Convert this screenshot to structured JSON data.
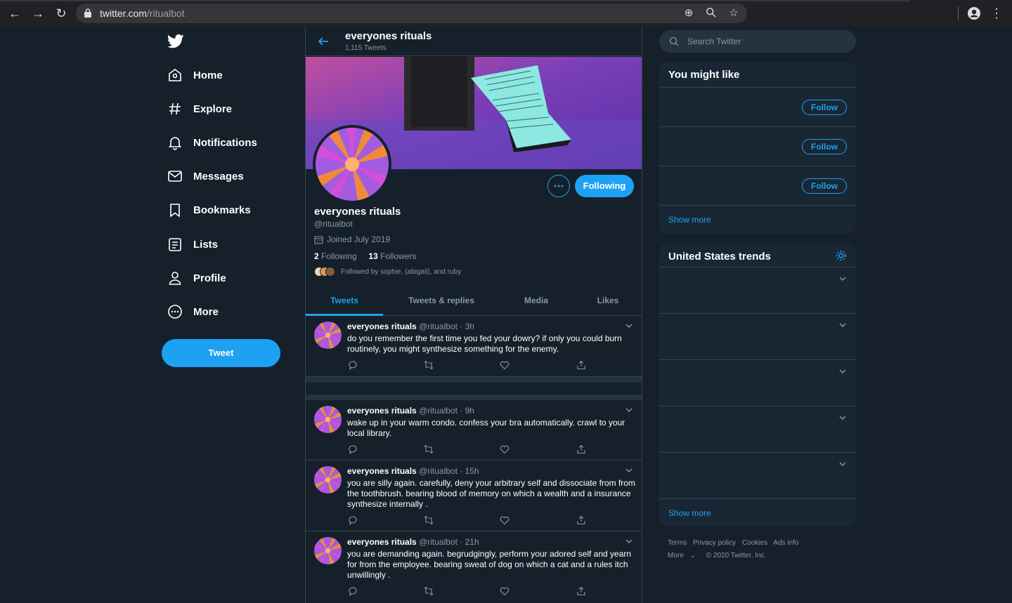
{
  "browser": {
    "url_host": "twitter.com",
    "url_path": "/ritualbot"
  },
  "nav": {
    "items": [
      {
        "label": "Home",
        "icon": "home-icon"
      },
      {
        "label": "Explore",
        "icon": "hashtag-icon"
      },
      {
        "label": "Notifications",
        "icon": "bell-icon"
      },
      {
        "label": "Messages",
        "icon": "envelope-icon"
      },
      {
        "label": "Bookmarks",
        "icon": "bookmark-icon"
      },
      {
        "label": "Lists",
        "icon": "list-icon"
      },
      {
        "label": "Profile",
        "icon": "person-icon"
      },
      {
        "label": "More",
        "icon": "more-circle-icon"
      }
    ],
    "tweet_button": "Tweet"
  },
  "header": {
    "name": "everyones rituals",
    "tweet_count": "1,115 Tweets"
  },
  "profile": {
    "name": "everyones rituals",
    "handle": "@ritualbot",
    "joined": "Joined July 2019",
    "following_count": "2",
    "following_label": "Following",
    "followers_count": "13",
    "followers_label": "Followers",
    "followed_by": "Followed by sophie, (abigail), and ruby",
    "following_button": "Following"
  },
  "tabs": [
    "Tweets",
    "Tweets & replies",
    "Media",
    "Likes"
  ],
  "tweets": [
    {
      "name": "everyones rituals",
      "meta": "@ritualbot · 3h",
      "text": "do you remember the first time you fed your dowry? if only you could burn routinely, you might synthesize something for the enemy."
    },
    {
      "name": "everyones rituals",
      "meta": "@ritualbot · 9h",
      "text": "wake up in your warm condo. confess your bra automatically. crawl to your local library."
    },
    {
      "name": "everyones rituals",
      "meta": "@ritualbot · 15h",
      "text": "you are silly again. carefully, deny your arbitrary self and dissociate from from the toothbrush. bearing  blood of memory on which a wealth and a insurance synthesize internally ."
    },
    {
      "name": "everyones rituals",
      "meta": "@ritualbot · 21h",
      "text": "you are demanding again. begrudgingly, perform your adored self and yearn for from the employee. bearing  sweat of dog on which a cat and a rules itch unwillingly ."
    }
  ],
  "right": {
    "search_placeholder": "Search Twitter",
    "might_like_title": "You might like",
    "follow_label": "Follow",
    "show_more": "Show more",
    "trends_title": "United States trends",
    "footer": {
      "terms": "Terms",
      "privacy": "Privacy policy",
      "cookies": "Cookies",
      "ads": "Ads info",
      "more": "More",
      "copyright": "© 2020 Twitter, Inc."
    }
  },
  "colors": {
    "background": "#15202b",
    "accent": "#1da1f2",
    "secondary_text": "#8899a6",
    "border": "#38444d"
  }
}
